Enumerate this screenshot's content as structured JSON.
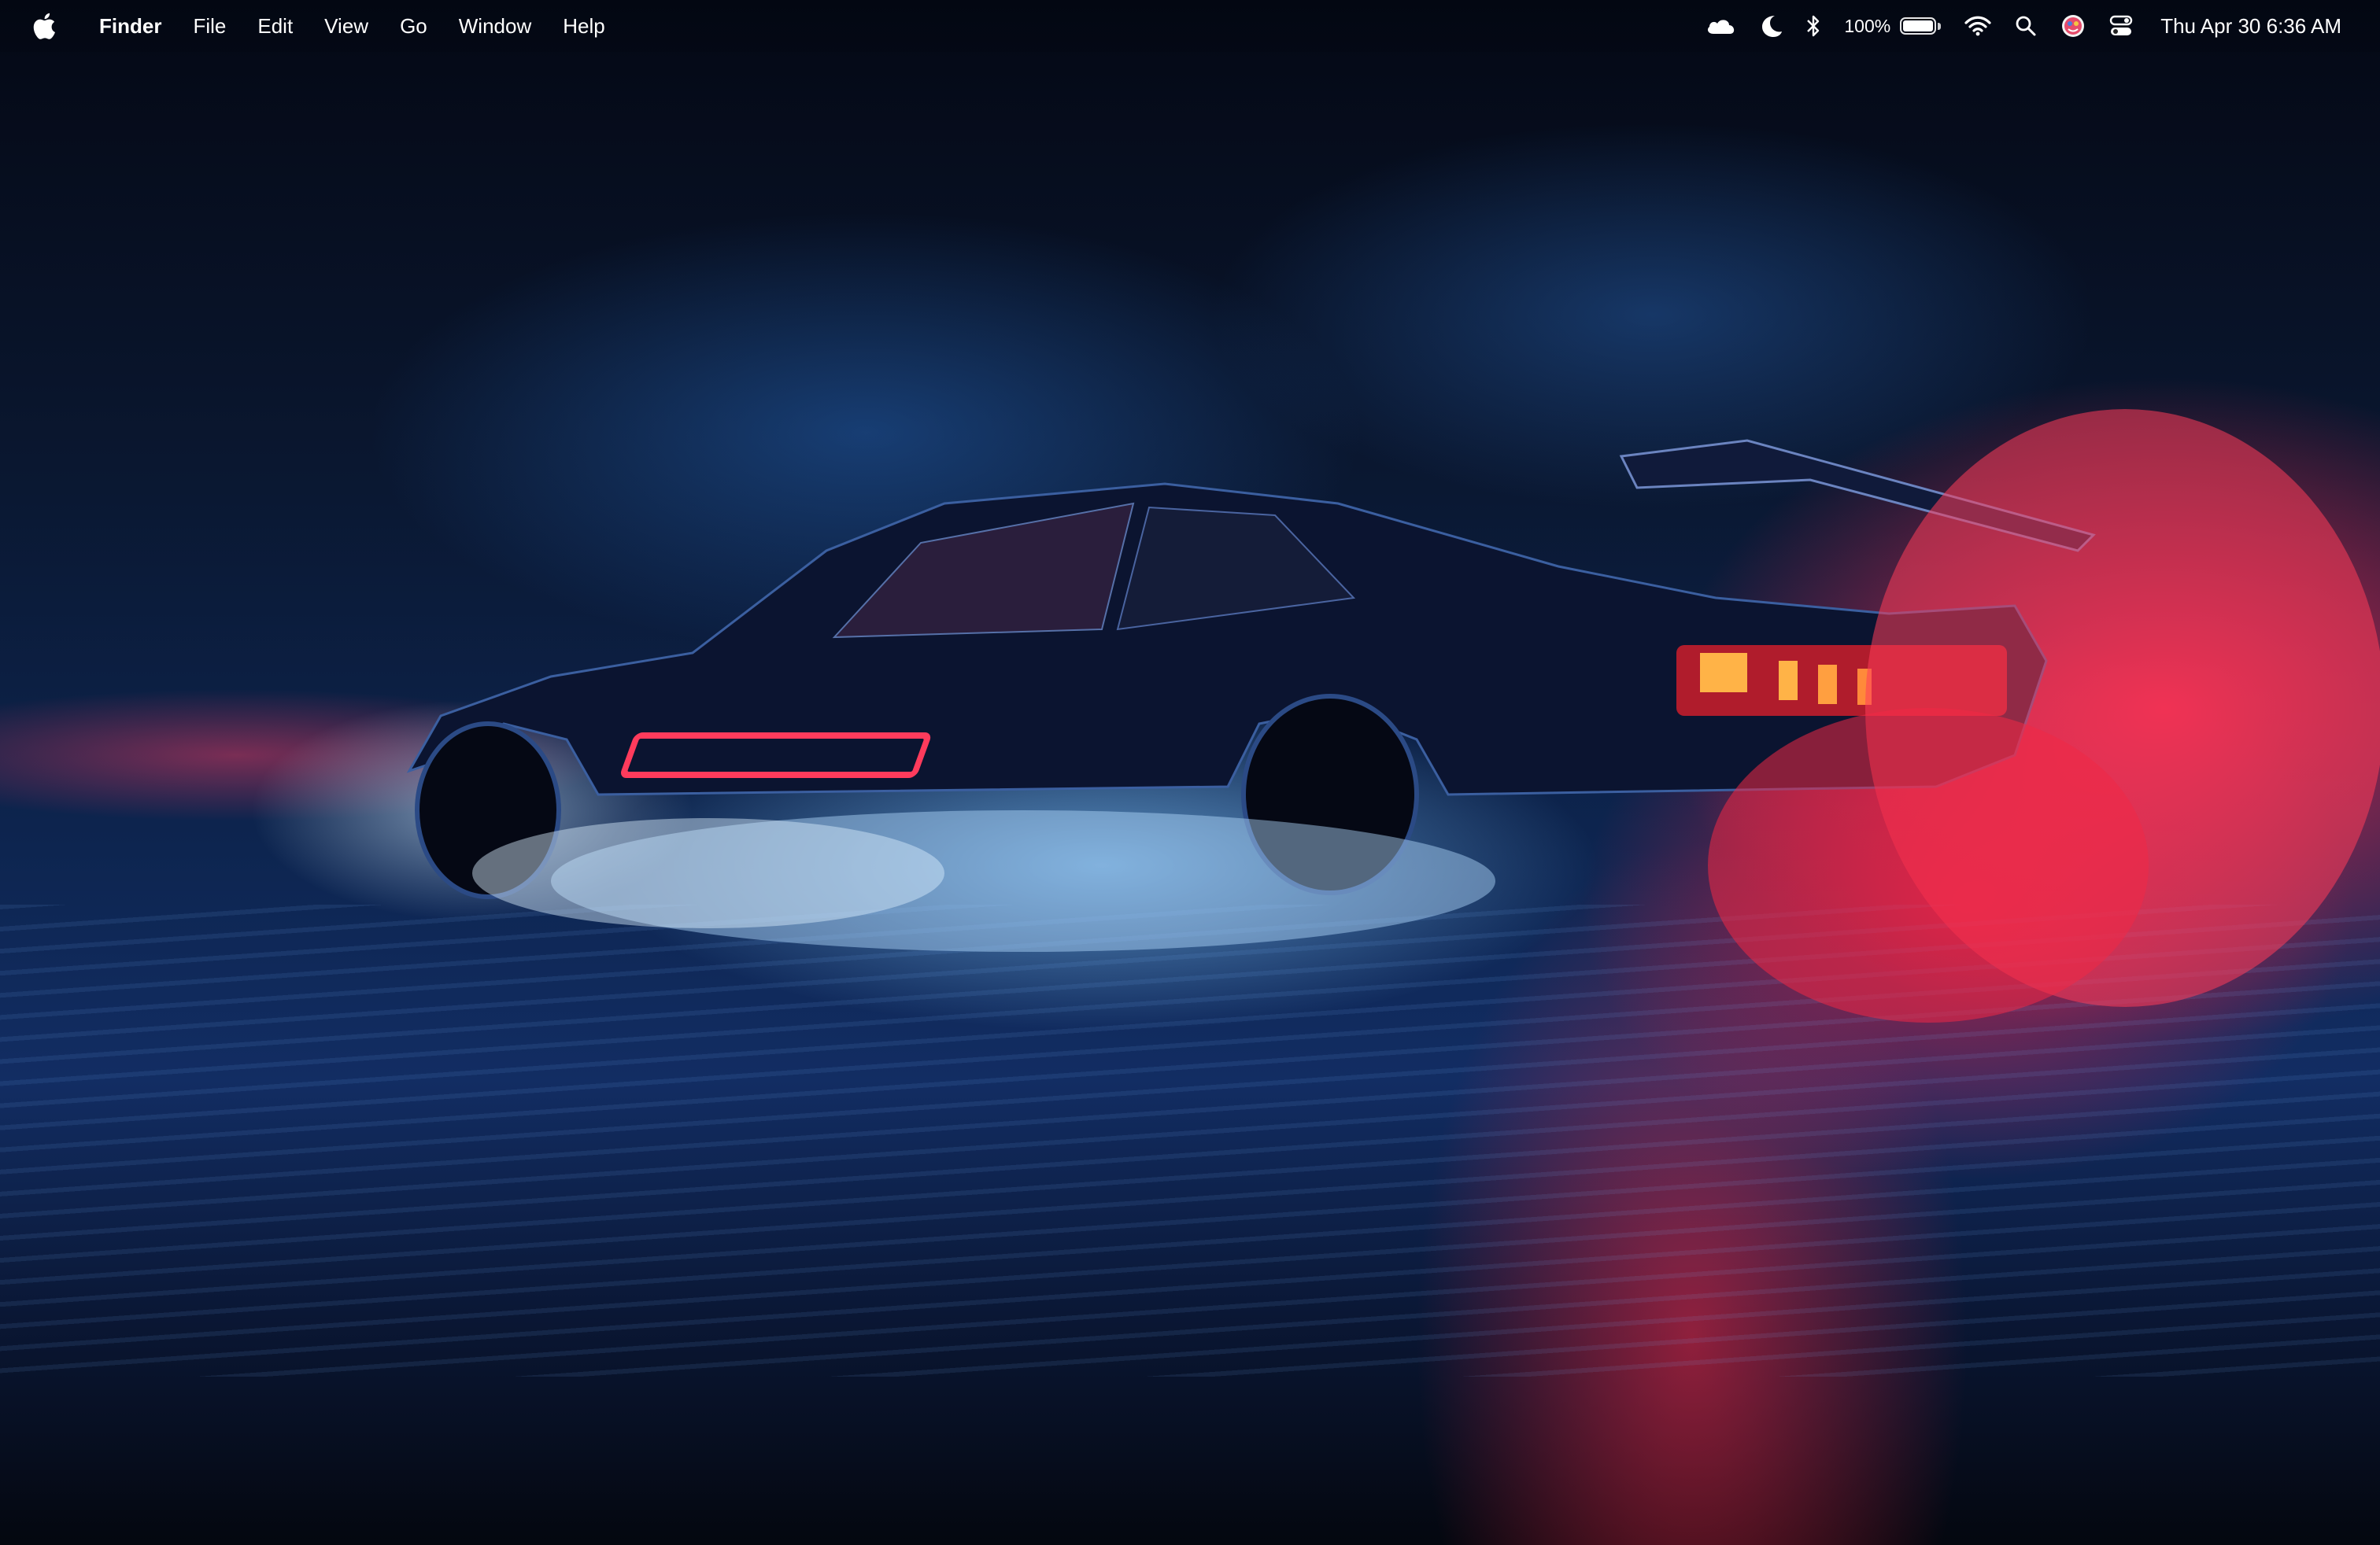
{
  "menubar": {
    "apple_icon": "apple-logo-icon",
    "app_name": "Finder",
    "items": [
      {
        "label": "File"
      },
      {
        "label": "Edit"
      },
      {
        "label": "View"
      },
      {
        "label": "Go"
      },
      {
        "label": "Window"
      },
      {
        "label": "Help"
      }
    ],
    "status": {
      "icons": [
        "cloud-icon",
        "moon-icon",
        "bluetooth-icon",
        "battery-icon",
        "wifi-icon",
        "search-icon",
        "user-avatar-icon",
        "control-center-icon"
      ],
      "battery_percent_label": "100%",
      "battery_level": 1.0,
      "datetime": "Thu Apr 30  6:36 AM"
    }
  },
  "desktop": {
    "wallpaper": "drifting-car-night-wallpaper",
    "colors": {
      "smoke_red": "#ff2850",
      "smoke_blue": "#82c8ff",
      "background": "#0a1730"
    }
  }
}
